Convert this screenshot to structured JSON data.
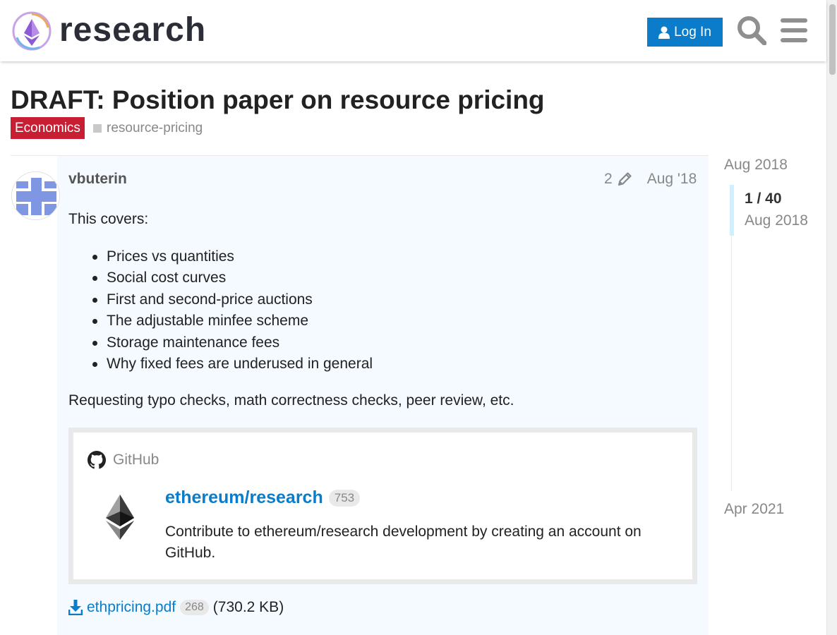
{
  "header": {
    "logo_text": "research",
    "login_label": "Log In"
  },
  "topic": {
    "title": "DRAFT: Position paper on resource pricing",
    "category": "Economics",
    "tag": "resource-pricing"
  },
  "post": {
    "username": "vbuterin",
    "edit_count": "2",
    "date": "Aug '18",
    "intro": "This covers:",
    "bullets": [
      "Prices vs quantities",
      "Social cost curves",
      "First and second-price auctions",
      "The adjustable minfee scheme",
      "Storage maintenance fees",
      "Why fixed fees are underused in general"
    ],
    "request": "Requesting typo checks, math correctness checks, peer review, etc.",
    "onebox": {
      "source": "GitHub",
      "title": "ethereum/research",
      "count": "753",
      "description": "Contribute to ethereum/research development by creating an account on GitHub."
    },
    "attachment": {
      "name": "ethpricing.pdf",
      "downloads": "268",
      "size": "(730.2 KB)"
    }
  },
  "timeline": {
    "start": "Aug 2018",
    "progress": "1 / 40",
    "current_date": "Aug 2018",
    "end": "Apr 2021"
  },
  "colors": {
    "accent": "#0a7cc9",
    "category": "#c71e33",
    "post_bg": "#f4faff"
  }
}
